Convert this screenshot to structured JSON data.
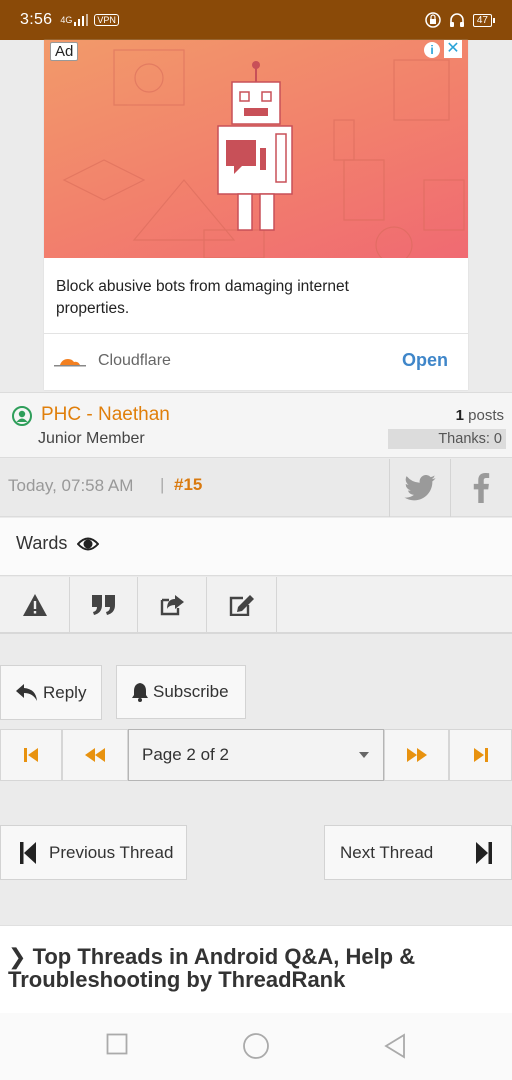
{
  "status_bar": {
    "time": "3:56",
    "signal": "4G",
    "vpn": "VPN",
    "battery": "47"
  },
  "ad": {
    "label": "Ad",
    "info_icon": "info-icon",
    "close_icon": "close-icon",
    "headline": "Block abusive bots from damaging internet properties.",
    "advertiser": "Cloudflare",
    "cta": "Open",
    "colors": {
      "gradient_start": "#f29a6a",
      "gradient_end": "#f06a72",
      "cta": "#3f86c9"
    }
  },
  "post": {
    "username": "PHC - Naethan",
    "user_title": "Junior Member",
    "posts_count": "1",
    "posts_label": "posts",
    "thanks": "Thanks: 0",
    "date": "Today, 07:58 AM",
    "separator": "|",
    "number": "#15",
    "text": "Wards",
    "share_icons": [
      "twitter-icon",
      "facebook-icon"
    ],
    "action_icons": [
      "report-icon",
      "quote-icon",
      "share-icon",
      "edit-icon"
    ],
    "colors": {
      "username": "#e07f0b",
      "post_number": "#d97a10"
    }
  },
  "buttons": {
    "reply": "Reply",
    "subscribe": "Subscribe"
  },
  "pager": {
    "current": "Page 2 of 2",
    "accent": "#e8920f"
  },
  "thread_nav": {
    "previous": "Previous Thread",
    "next": "Next Thread"
  },
  "top_threads": {
    "title_line1": "Top Threads in Android Q&A, Help &",
    "title_line2": "Troubleshooting by ThreadRank"
  }
}
